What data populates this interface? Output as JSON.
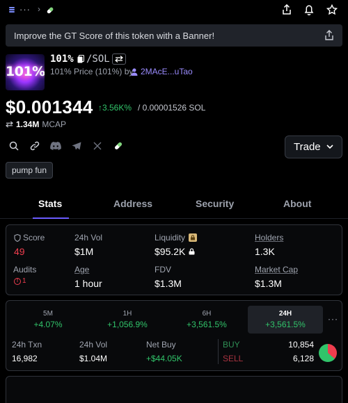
{
  "topbar": {
    "dots": "···",
    "chevron": "›"
  },
  "banner": {
    "text": "Improve the GT Score of this token with a Banner!"
  },
  "token": {
    "logo_text": "101%",
    "name": "101%",
    "pair": "/SOL",
    "subtitle": "101% Price (101%) by",
    "creator": "2MAcE...uTao",
    "price": "$0.001344",
    "price_change": "↑3.56K%",
    "price_sol": "/ 0.00001526 SOL",
    "mcap_value": "1.34M",
    "mcap_label": "MCAP",
    "tag": "pump fun"
  },
  "trade_button": {
    "label": "Trade"
  },
  "tabs": [
    {
      "label": "Stats",
      "active": true
    },
    {
      "label": "Address",
      "active": false
    },
    {
      "label": "Security",
      "active": false
    },
    {
      "label": "About",
      "active": false
    }
  ],
  "stats": {
    "score_label": "Score",
    "score_value": "49",
    "vol_label": "24h Vol",
    "vol_value": "$1M",
    "liquidity_label": "Liquidity",
    "liquidity_value": "$95.2K",
    "holders_label": "Holders",
    "holders_value": "1.3K",
    "audits_label": "Audits",
    "audits_value": "1",
    "age_label": "Age",
    "age_value": "1 hour",
    "fdv_label": "FDV",
    "fdv_value": "$1.3M",
    "mcap_label": "Market Cap",
    "mcap_value": "$1.3M"
  },
  "periods": [
    {
      "label": "5M",
      "value": "+4.07%",
      "active": false
    },
    {
      "label": "1H",
      "value": "+1,056.9%",
      "active": false
    },
    {
      "label": "6H",
      "value": "+3,561.5%",
      "active": false
    },
    {
      "label": "24H",
      "value": "+3,561.5%",
      "active": true
    }
  ],
  "period_more": "···",
  "txns": {
    "txn_label": "24h Txn",
    "txn_value": "16,982",
    "vol_label": "24h Vol",
    "vol_value": "$1.04M",
    "netbuy_label": "Net Buy",
    "netbuy_value": "+$44.05K",
    "buy_label": "BUY",
    "buy_value": "10,854",
    "sell_label": "SELL",
    "sell_value": "6,128"
  },
  "colors": {
    "accent": "#6b5cff",
    "positive": "#31c46a",
    "negative": "#ee3d4e",
    "background": "#000000"
  }
}
